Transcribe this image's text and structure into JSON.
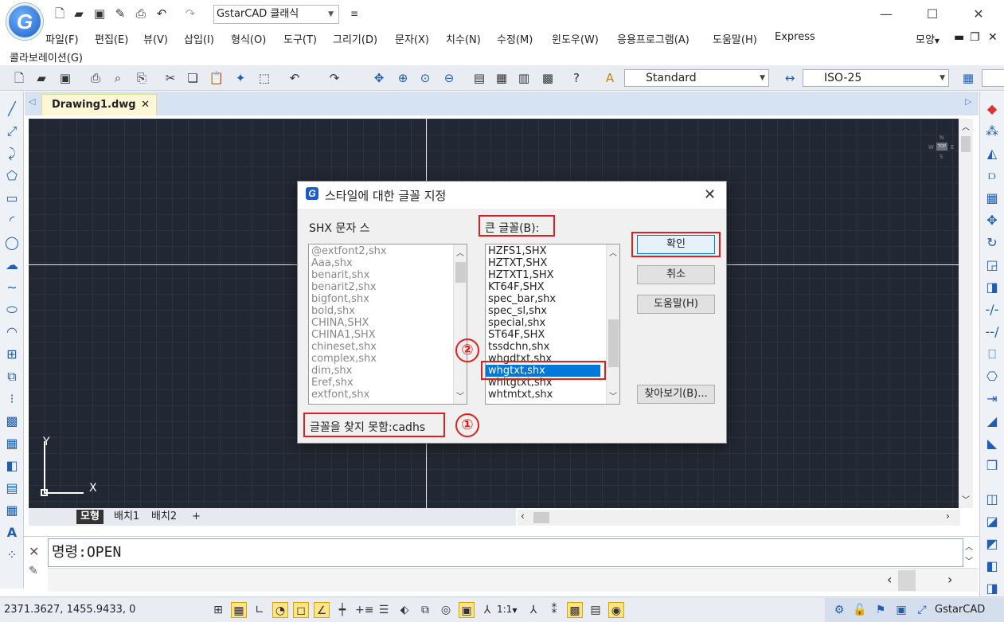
{
  "app": {
    "logo_letter": "G",
    "workspace": "GstarCAD 클래식"
  },
  "menu": [
    "파일(F)",
    "편집(E)",
    "뷰(V)",
    "삽입(I)",
    "형식(O)",
    "도구(T)",
    "그리기(D)",
    "문자(X)",
    "치수(N)",
    "수정(M)",
    "윈도우(W)",
    "응용프로그램(A)",
    "도움말(H)",
    "Express"
  ],
  "menu_row2": "콜라보레이션(G)",
  "menu_right": "모양",
  "toolbar": {
    "text_style": "Standard",
    "dim_style": "ISO-25"
  },
  "document_tab": {
    "label": "Drawing1.dwg",
    "close": "✕"
  },
  "viewcube": {
    "n": "N",
    "s": "S",
    "e": "E",
    "w": "W",
    "top": "TOP"
  },
  "ucs": {
    "y": "Y",
    "x": "X"
  },
  "layout_tabs": [
    "모형",
    "배치1",
    "배치2",
    "+"
  ],
  "command": {
    "text": "명령:OPEN"
  },
  "status": {
    "coords": "2371.3627, 1455.9433, 0",
    "scale": "1:1",
    "brand": "GstarCAD"
  },
  "dialog": {
    "title": "스타일에 대한 글꼴 지정",
    "shx_label": "SHX 문자 스",
    "big_label": "큰 글꼴(B):",
    "shx_list": [
      "@extfont2,shx",
      "Aaa,shx",
      "benarit,shx",
      "benarit2,shx",
      "bigfont,shx",
      "bold,shx",
      "CHINA,SHX",
      "CHINA1,SHX",
      "chineset,shx",
      "complex,shx",
      "dim,shx",
      "Eref,shx",
      "extfont,shx"
    ],
    "big_list": [
      "HZFS1,SHX",
      "HZTXT,SHX",
      "HZTXT1,SHX",
      "KT64F,SHX",
      "spec_bar,shx",
      "spec_sl,shx",
      "special,shx",
      "ST64F,SHX",
      "tssdchn,shx",
      "whgdtxt,shx",
      "whgtxt,shx",
      "whitgtxt,shx",
      "whtmtxt,shx"
    ],
    "big_selected_index": 10,
    "ok": "확인",
    "cancel": "취소",
    "help": "도움말(H)",
    "browse": "찾아보기(B)...",
    "missing": "글꼴을 찾지 못함:cadhs",
    "marker1": "①",
    "marker2": "②"
  },
  "colors": {
    "accent": "#0078d7",
    "highlight_red": "#e02020",
    "canvas": "#222833"
  }
}
